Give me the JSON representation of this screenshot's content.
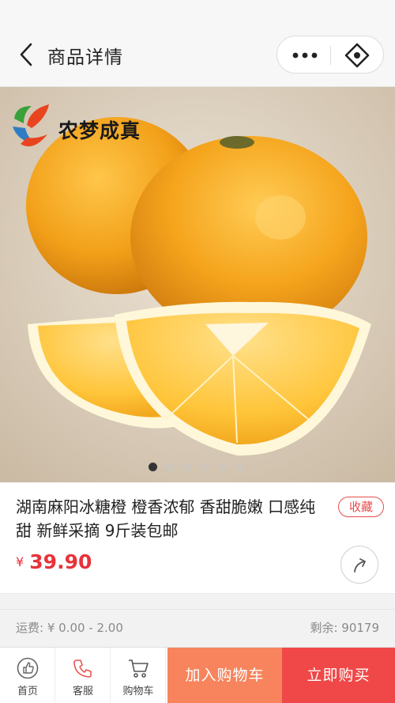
{
  "header": {
    "title": "商品详情",
    "back_icon": "chevron-left-icon",
    "more_icon": "more-dots-icon",
    "target_icon": "target-icon"
  },
  "hero": {
    "brand_name": "农梦成真",
    "image_subject": "oranges",
    "carousel": {
      "count": 6,
      "active_index": 0
    }
  },
  "product": {
    "title": "湖南麻阳冰糖橙 橙香浓郁 香甜脆嫩 口感纯甜 新鲜采摘 9斤装包邮",
    "favorite_label": "收藏",
    "price_symbol": "¥",
    "price": "39.90",
    "share_icon": "share-arrow-icon"
  },
  "shipping": {
    "text": "运费: ¥ 0.00 - 2.00",
    "stock_text": "剩余: 90179"
  },
  "bottom_bar": {
    "home_label": "首页",
    "service_label": "客服",
    "cart_label": "购物车",
    "add_to_cart_label": "加入购物车",
    "buy_now_label": "立即购买"
  },
  "colors": {
    "accent_red": "#f04848",
    "accent_orange": "#f7845c",
    "price_red": "#e8333a"
  }
}
